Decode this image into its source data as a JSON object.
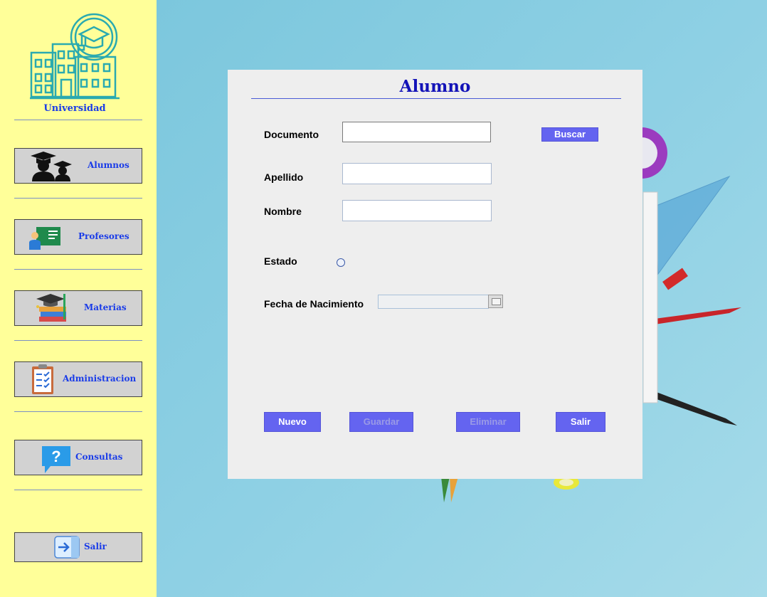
{
  "sidebar": {
    "logo_title": "Universidad",
    "items": [
      {
        "label": "Alumnos",
        "icon": "students-icon"
      },
      {
        "label": "Profesores",
        "icon": "teacher-board-icon"
      },
      {
        "label": "Materias",
        "icon": "books-graduation-icon"
      },
      {
        "label": "Administracion",
        "icon": "clipboard-icon"
      },
      {
        "label": "Consultas",
        "icon": "question-bubble-icon"
      },
      {
        "label": "Salir",
        "icon": "exit-arrow-icon"
      }
    ]
  },
  "form": {
    "title": "Alumno",
    "documento_label": "Documento",
    "documento_value": "",
    "buscar_label": "Buscar",
    "apellido_label": "Apellido",
    "apellido_value": "",
    "nombre_label": "Nombre",
    "nombre_value": "",
    "estado_label": "Estado",
    "fecha_label": "Fecha de Nacimiento",
    "fecha_value": "",
    "buttons": {
      "nuevo": "Nuevo",
      "guardar": "Guardar",
      "eliminar": "Eliminar",
      "salir": "Salir"
    }
  },
  "colors": {
    "sidebar_bg": "#ffff99",
    "accent_text": "#1a3ce8",
    "button_bg": "#6464f0",
    "panel_bg": "#eeeeee",
    "background": "#8ed0e4"
  }
}
